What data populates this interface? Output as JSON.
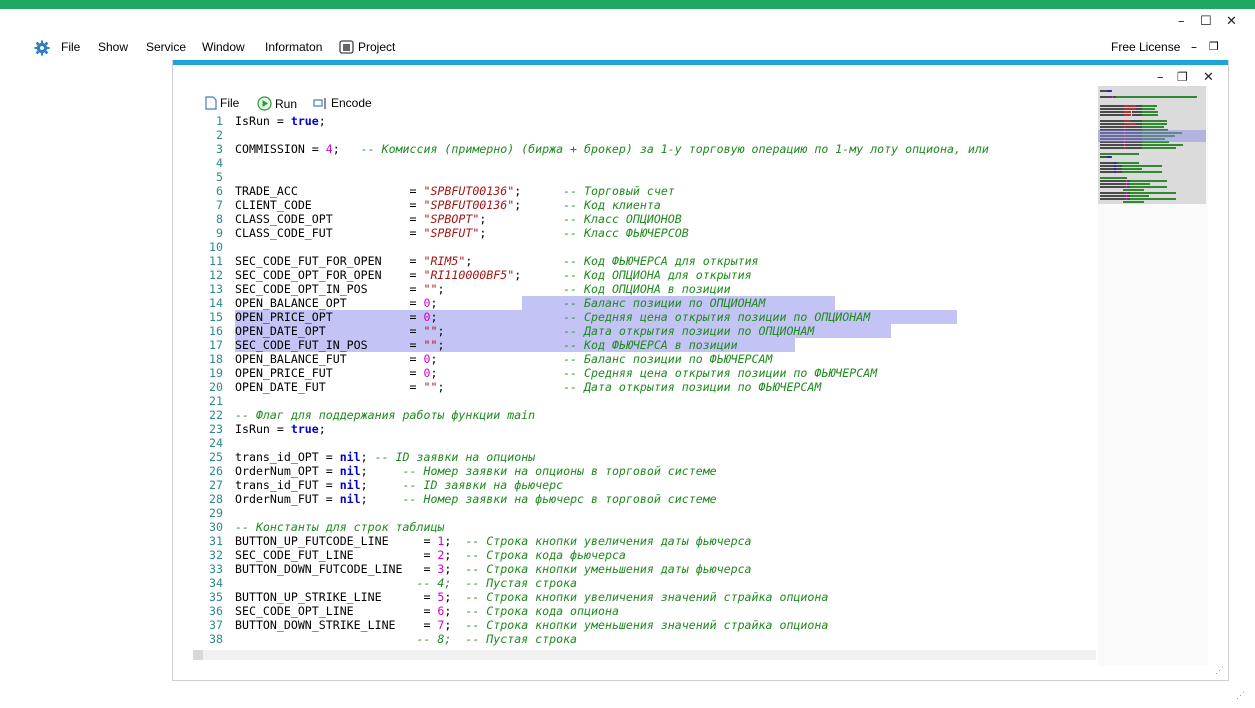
{
  "window_controls": {
    "minimize": "–",
    "maximize": "☐",
    "close": "✕"
  },
  "menu": {
    "items": [
      "File",
      "Show",
      "Service",
      "Window",
      "Informaton",
      "Project"
    ],
    "right": {
      "license": "Free License",
      "minimize": "–",
      "restore": "❐"
    }
  },
  "inner_window": {
    "controls": {
      "minimize": "–",
      "restore": "❐",
      "close": "✕"
    },
    "toolbar": {
      "file": "File",
      "run": "Run",
      "encode": "Encode"
    }
  },
  "code_lines": [
    {
      "n": "1",
      "t": [
        [
          "IsRun = ",
          ""
        ],
        [
          "true",
          "kw"
        ],
        [
          ";",
          ""
        ]
      ]
    },
    {
      "n": "2",
      "t": []
    },
    {
      "n": "3",
      "t": [
        [
          "COMMISSION = ",
          ""
        ],
        [
          "4",
          "num"
        ],
        [
          ";   ",
          ""
        ],
        [
          "-- Комиссия (примерно) (биржа + брокер) за 1-у торговую операцию по 1-му лоту опциона, или",
          "cmt"
        ]
      ]
    },
    {
      "n": "4",
      "t": []
    },
    {
      "n": "5",
      "t": []
    },
    {
      "n": "6",
      "t": [
        [
          "TRADE_ACC                = ",
          ""
        ],
        [
          "\"SPBFUT00136\"",
          "str"
        ],
        [
          ";      ",
          ""
        ],
        [
          "-- Торговый счет",
          "cmt"
        ]
      ]
    },
    {
      "n": "7",
      "t": [
        [
          "CLIENT_CODE              = ",
          ""
        ],
        [
          "\"SPBFUT00136\"",
          "str"
        ],
        [
          ";      ",
          ""
        ],
        [
          "-- Код клиента",
          "cmt"
        ]
      ]
    },
    {
      "n": "8",
      "t": [
        [
          "CLASS_CODE_OPT           = ",
          ""
        ],
        [
          "\"SPBOPT\"",
          "str"
        ],
        [
          ";           ",
          ""
        ],
        [
          "-- Класс ОПЦИОНОВ",
          "cmt"
        ]
      ]
    },
    {
      "n": "9",
      "t": [
        [
          "CLASS_CODE_FUT           = ",
          ""
        ],
        [
          "\"SPBFUT\"",
          "str"
        ],
        [
          ";           ",
          ""
        ],
        [
          "-- Класс ФЬЮЧЕРСОВ",
          "cmt"
        ]
      ]
    },
    {
      "n": "10",
      "t": []
    },
    {
      "n": "11",
      "t": [
        [
          "SEC_CODE_FUT_FOR_OPEN    = ",
          ""
        ],
        [
          "\"RIM5\"",
          "str"
        ],
        [
          ";             ",
          ""
        ],
        [
          "-- Код ФЬЮЧЕРСА для открытия",
          "cmt"
        ]
      ]
    },
    {
      "n": "12",
      "t": [
        [
          "SEC_CODE_OPT_FOR_OPEN    = ",
          ""
        ],
        [
          "\"RI110000BF5\"",
          "str"
        ],
        [
          ";      ",
          ""
        ],
        [
          "-- Код ОПЦИОНА для открытия",
          "cmt"
        ]
      ]
    },
    {
      "n": "13",
      "t": [
        [
          "SEC_CODE_OPT_IN_POS      = ",
          ""
        ],
        [
          "\"\"",
          "str"
        ],
        [
          ";                 ",
          ""
        ],
        [
          "-- Код ОПЦИОНА в позиции",
          "cmt"
        ]
      ]
    },
    {
      "n": "14",
      "t": [
        [
          "OPEN_BALANCE_OPT         = ",
          ""
        ],
        [
          "0",
          "num"
        ],
        [
          ";                  ",
          ""
        ],
        [
          "-- Баланс позиции по ОПЦИОНАМ",
          "cmt"
        ]
      ]
    },
    {
      "n": "15",
      "t": [
        [
          "OPEN_PRICE_OPT           = ",
          ""
        ],
        [
          "0",
          "num"
        ],
        [
          ";                  ",
          ""
        ],
        [
          "-- Средняя цена открытия позиции по ОПЦИОНАМ",
          "cmt"
        ]
      ]
    },
    {
      "n": "16",
      "t": [
        [
          "OPEN_DATE_OPT            = ",
          ""
        ],
        [
          "\"\"",
          "str"
        ],
        [
          ";                 ",
          ""
        ],
        [
          "-- Дата открытия позиции по ОПЦИОНАМ",
          "cmt"
        ]
      ]
    },
    {
      "n": "17",
      "t": [
        [
          "SEC_CODE_FUT_IN_POS      = ",
          ""
        ],
        [
          "\"\"",
          "str"
        ],
        [
          ";                 ",
          ""
        ],
        [
          "-- Код ФЬЮЧЕРСА в позиции",
          "cmt"
        ]
      ]
    },
    {
      "n": "18",
      "t": [
        [
          "OPEN_BALANCE_FUT         = ",
          ""
        ],
        [
          "0",
          "num"
        ],
        [
          ";                  ",
          ""
        ],
        [
          "-- Баланс позиции по ФЬЮЧЕРСАМ",
          "cmt"
        ]
      ]
    },
    {
      "n": "19",
      "t": [
        [
          "OPEN_PRICE_FUT           = ",
          ""
        ],
        [
          "0",
          "num"
        ],
        [
          ";                  ",
          ""
        ],
        [
          "-- Средняя цена открытия позиции по ФЬЮЧЕРСАМ",
          "cmt"
        ]
      ]
    },
    {
      "n": "20",
      "t": [
        [
          "OPEN_DATE_FUT            = ",
          ""
        ],
        [
          "\"\"",
          "str"
        ],
        [
          ";                 ",
          ""
        ],
        [
          "-- Дата открытия позиции по ФЬЮЧЕРСАМ",
          "cmt"
        ]
      ]
    },
    {
      "n": "21",
      "t": []
    },
    {
      "n": "22",
      "t": [
        [
          "-- Флаг для поддержания работы функции main",
          "cmt"
        ]
      ]
    },
    {
      "n": "23",
      "t": [
        [
          "IsRun = ",
          ""
        ],
        [
          "true",
          "kw"
        ],
        [
          ";",
          ""
        ]
      ]
    },
    {
      "n": "24",
      "t": []
    },
    {
      "n": "25",
      "t": [
        [
          "trans_id_OPT = ",
          ""
        ],
        [
          "nil",
          "kw"
        ],
        [
          "; ",
          ""
        ],
        [
          "-- ID заявки на опционы",
          "cmt"
        ]
      ]
    },
    {
      "n": "26",
      "t": [
        [
          "OrderNum_OPT = ",
          ""
        ],
        [
          "nil",
          "kw"
        ],
        [
          ";     ",
          ""
        ],
        [
          "-- Номер заявки на опционы в торговой системе",
          "cmt"
        ]
      ]
    },
    {
      "n": "27",
      "t": [
        [
          "trans_id_FUT = ",
          ""
        ],
        [
          "nil",
          "kw"
        ],
        [
          ";     ",
          ""
        ],
        [
          "-- ID заявки на фьючерс",
          "cmt"
        ]
      ]
    },
    {
      "n": "28",
      "t": [
        [
          "OrderNum_FUT = ",
          ""
        ],
        [
          "nil",
          "kw"
        ],
        [
          ";     ",
          ""
        ],
        [
          "-- Номер заявки на фьючерс в торговой системе",
          "cmt"
        ]
      ]
    },
    {
      "n": "29",
      "t": []
    },
    {
      "n": "30",
      "t": [
        [
          "-- Константы для строк таблицы",
          "cmt"
        ]
      ]
    },
    {
      "n": "31",
      "t": [
        [
          "BUTTON_UP_FUTCODE_LINE     = ",
          ""
        ],
        [
          "1",
          "num"
        ],
        [
          ";  ",
          ""
        ],
        [
          "-- Строка кнопки увеличения даты фьючерса",
          "cmt"
        ]
      ]
    },
    {
      "n": "32",
      "t": [
        [
          "SEC_CODE_FUT_LINE          = ",
          ""
        ],
        [
          "2",
          "num"
        ],
        [
          ";  ",
          ""
        ],
        [
          "-- Строка кода фьючерса",
          "cmt"
        ]
      ]
    },
    {
      "n": "33",
      "t": [
        [
          "BUTTON_DOWN_FUTCODE_LINE   = ",
          ""
        ],
        [
          "3",
          "num"
        ],
        [
          ";  ",
          ""
        ],
        [
          "-- Строка кнопки уменьшения даты фьючерса",
          "cmt"
        ]
      ]
    },
    {
      "n": "34",
      "t": [
        [
          "                          ",
          ""
        ],
        [
          "-- 4;  -- Пустая строка",
          "cmt"
        ]
      ]
    },
    {
      "n": "35",
      "t": [
        [
          "BUTTON_UP_STRIKE_LINE      = ",
          ""
        ],
        [
          "5",
          "num"
        ],
        [
          ";  ",
          ""
        ],
        [
          "-- Строка кнопки увеличения значений страйка опциона",
          "cmt"
        ]
      ]
    },
    {
      "n": "36",
      "t": [
        [
          "SEC_CODE_OPT_LINE          = ",
          ""
        ],
        [
          "6",
          "num"
        ],
        [
          ";  ",
          ""
        ],
        [
          "-- Строка кода опциона",
          "cmt"
        ]
      ]
    },
    {
      "n": "37",
      "t": [
        [
          "BUTTON_DOWN_STRIKE_LINE    = ",
          ""
        ],
        [
          "7",
          "num"
        ],
        [
          ";  ",
          ""
        ],
        [
          "-- Строка кнопки уменьшения значений страйка опциона",
          "cmt"
        ]
      ]
    },
    {
      "n": "38",
      "t": [
        [
          "                          ",
          ""
        ],
        [
          "-- 8;  -- Пустая строка",
          "cmt"
        ]
      ]
    }
  ],
  "colors": {
    "accent_green": "#1fa85f",
    "accent_blue": "#1fa3d8",
    "selection": "#c3c3f5",
    "keyword": "#0000cc",
    "string": "#a31515",
    "number": "#d000d0",
    "comment": "#1f8a1f"
  },
  "icons": [
    "gear-icon",
    "project-icon",
    "file-icon",
    "run-icon",
    "encode-icon"
  ]
}
